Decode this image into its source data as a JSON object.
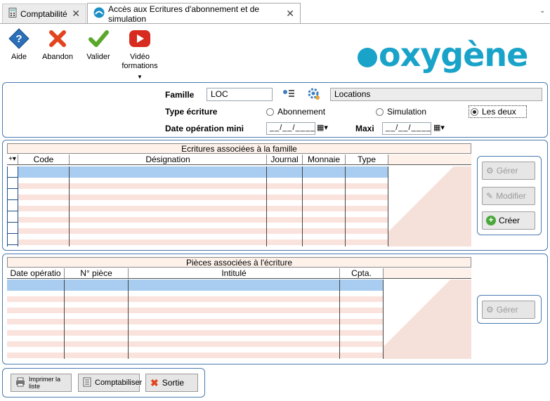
{
  "tabs": [
    {
      "label": "Comptabilité"
    },
    {
      "label": "Accès aux Ecritures d'abonnement et de simulation"
    }
  ],
  "toolbar": {
    "help": "Aide",
    "abandon": "Abandon",
    "validate": "Valider",
    "video_line1": "Vidéo",
    "video_line2": "formations"
  },
  "logo": {
    "text": "oxygène",
    "color": "#1aa3c9"
  },
  "form": {
    "famille_label": "Famille",
    "famille_value": "LOC",
    "famille_desc": "Locations",
    "type_label": "Type écriture",
    "radio_abonnement": "Abonnement",
    "radio_simulation": "Simulation",
    "radio_lesdeux": "Les deux",
    "selected": "Les deux",
    "date_label": "Date opération mini",
    "date_min": "__/__/____",
    "maxi_label": "Maxi",
    "date_max": "__/__/____"
  },
  "ecritures": {
    "title": "Ecritures associées à la famille",
    "columns": [
      "Code",
      "Désignation",
      "Journal",
      "Monnaie",
      "Type"
    ],
    "buttons": {
      "gerer": "Gérer",
      "modifier": "Modifier",
      "creer": "Créer"
    }
  },
  "pieces": {
    "title": "Pièces associées à l'écriture",
    "columns": [
      "Date opératio",
      "N° pièce",
      "Intitulé",
      "Cpta."
    ],
    "buttons": {
      "gerer": "Gérer"
    }
  },
  "bottom": {
    "print": "Imprimer la liste",
    "comptabiliser": "Comptabiliser",
    "sortie": "Sortie"
  }
}
